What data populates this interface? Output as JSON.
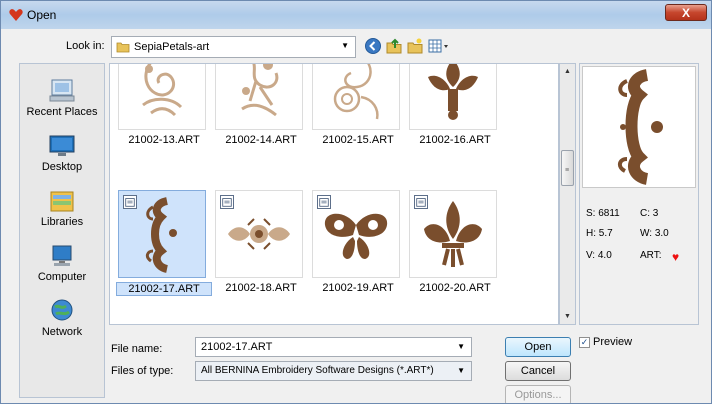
{
  "window": {
    "title": "Open",
    "close_label": "X"
  },
  "look_in": {
    "label": "Look in:",
    "value": "SepiaPetals-art"
  },
  "toolbar": {
    "icons": [
      "back-icon",
      "up-folder-icon",
      "new-folder-icon",
      "views-menu-icon"
    ]
  },
  "places": [
    {
      "label": "Recent Places",
      "icon": "recent-places-icon"
    },
    {
      "label": "Desktop",
      "icon": "desktop-icon"
    },
    {
      "label": "Libraries",
      "icon": "libraries-icon"
    },
    {
      "label": "Computer",
      "icon": "computer-icon"
    },
    {
      "label": "Network",
      "icon": "network-icon"
    }
  ],
  "files": [
    {
      "name": "21002-13.ART",
      "selected": false
    },
    {
      "name": "21002-14.ART",
      "selected": false
    },
    {
      "name": "21002-15.ART",
      "selected": false
    },
    {
      "name": "21002-16.ART",
      "selected": false
    },
    {
      "name": "21002-17.ART",
      "selected": true
    },
    {
      "name": "21002-18.ART",
      "selected": false
    },
    {
      "name": "21002-19.ART",
      "selected": false
    },
    {
      "name": "21002-20.ART",
      "selected": false
    }
  ],
  "stats": {
    "s": "S: 6811",
    "c": "C: 3",
    "h": "H: 5.7",
    "w": "W: 3.0",
    "v": "V: 4.0",
    "art": "ART:"
  },
  "colors": {
    "embroidery": "#7a4e2d",
    "embroidery_light": "#c9a98a",
    "accent_red": "#e11111"
  },
  "file_name": {
    "label": "File name:",
    "value": "21002-17.ART"
  },
  "file_type": {
    "label": "Files of type:",
    "value": "All BERNINA Embroidery Software Designs (*.ART*)"
  },
  "buttons": {
    "open": "Open",
    "cancel": "Cancel",
    "options": "Options..."
  },
  "preview": {
    "label": "Preview",
    "checked": true
  }
}
